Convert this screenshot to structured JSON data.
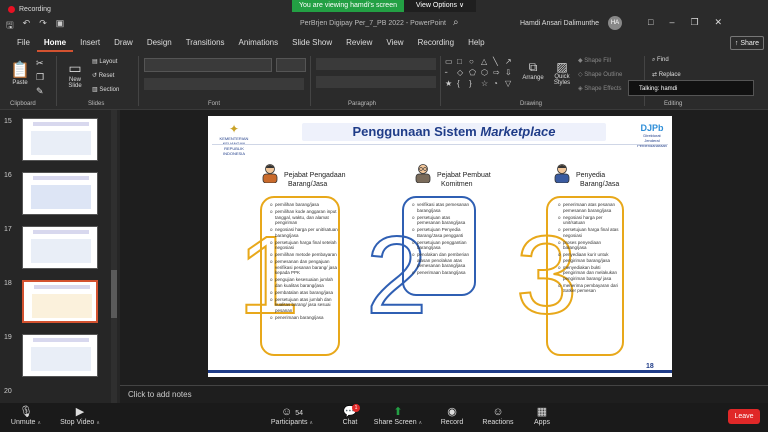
{
  "recording": "Recording",
  "banner": {
    "viewing": "You are viewing hamdi's screen",
    "view_options": "View Options"
  },
  "window": {
    "title": "PerBrjen Digipay Per_7_PB 2022  -  PowerPoint",
    "user": "Hamdi Ansari Dalimunthe",
    "user_initials": "HA"
  },
  "menu": [
    "File",
    "Home",
    "Insert",
    "Draw",
    "Design",
    "Transitions",
    "Animations",
    "Slide Show",
    "Review",
    "View",
    "Recording",
    "Help"
  ],
  "share_label": "Share",
  "ribbon": {
    "paste": "Paste",
    "new_slide": "New Slide",
    "layout": "Layout",
    "reset": "Reset",
    "section": "Section",
    "arrange": "Arrange",
    "quick_styles": "Quick Styles",
    "shape_fill": "Shape Fill",
    "shape_outline": "Shape Outline",
    "shape_effects": "Shape Effects",
    "find": "Find",
    "replace": "Replace",
    "groups": {
      "clipboard": "Clipboard",
      "slides": "Slides",
      "font": "Font",
      "paragraph": "Paragraph",
      "drawing": "Drawing",
      "editing": "Editing"
    }
  },
  "talking": "Talking: hamdi",
  "thumbnails": [
    "15",
    "16",
    "17",
    "18",
    "19",
    "20"
  ],
  "notes_placeholder": "Click to add notes",
  "slide": {
    "title_plain": "Penggunaan Sistem ",
    "title_em": "Marketplace",
    "logo_left": "KEMENTERIAN KEUANGAN REPUBLIK INDONESIA",
    "logo_right": "DJPb",
    "logo_right_sub": "Direktorat Jenderal Perbendaharaan",
    "page": "18",
    "roles": [
      {
        "line1": "Pejabat Pengadaan",
        "line2": "Barang/Jasa",
        "number": "1",
        "items": [
          "pemilihan barang/jasa",
          "pemilihan kode anggaran input tanggal, waktu, dan alamat pengiriman",
          "negosiasi harga per unit/satuan barang/jasa",
          "persetujuan harga final setelah negosiasi",
          "pemilihan metode pembayaran",
          "pemesanan dan pengajuan verifikasi pesanan barang/ jasa kepada PPK",
          "pengujian kesesuaian jumlah dan kualitas barang/jasa",
          "pembatalan atas barang/jasa",
          "persetujuan atas jumlah dan kualitas barang/ jasa sesuai pesanan",
          "penerimaan barang/jasa"
        ]
      },
      {
        "line1": "Pejabat Pembuat",
        "line2": "Komitmen",
        "number": "2",
        "items": [
          "verifikasi atas pemesanan barang/jasa",
          "persetujuan atas pemesanan barang/jasa",
          "persetujuan Penyedia Barang/Jasa pengganti",
          "persetujuan penggantian barang/jasa",
          "penolakan dan pemberian alasan penolakan atas pemesanan barang/jasa",
          "penerimaan barang/jasa"
        ]
      },
      {
        "line1": "Penyedia",
        "line2": "Barang/Jasa",
        "number": "3",
        "items": [
          "penerimaan atas pesanan pemesanan barang/jasa",
          "negosiasi harga per unit/satuan",
          "persetujuan harga final atas negosiasi",
          "proses penyediaan barang/jasa",
          "penyediaan kurir untuk pengiriman barang/jasa",
          "menyediakan bukti pengiriman dan melakukan pengiriman barang/ jasa",
          "menerima pembayaran dari Satker pemesan"
        ]
      }
    ]
  },
  "zoom": {
    "unmute": "Unmute",
    "stop_video": "Stop Video",
    "participants": "Participants",
    "participants_count": "54",
    "chat": "Chat",
    "chat_badge": "1",
    "share_screen": "Share Screen",
    "record": "Record",
    "reactions": "Reactions",
    "apps": "Apps",
    "leave": "Leave"
  },
  "colors": {
    "accent": "#d35230",
    "number_outline": "#e8a81a",
    "number_blue": "#2f5fb3",
    "share_green": "#23a044",
    "leave_red": "#e02828",
    "brand_blue": "#1f3c88"
  }
}
